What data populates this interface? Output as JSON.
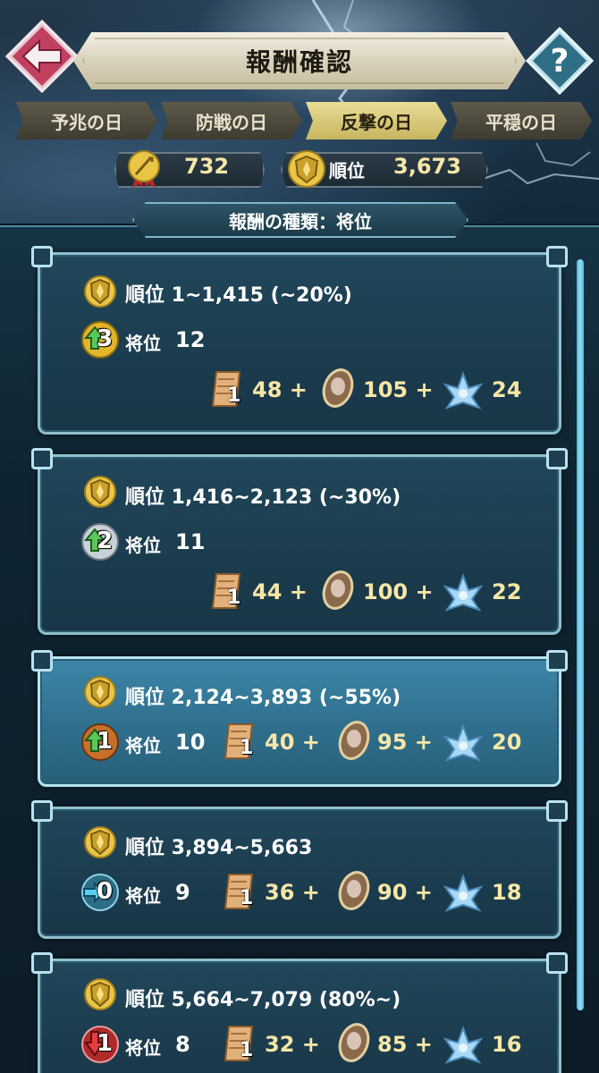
{
  "header": {
    "title": "報酬確認",
    "back_icon": "arrow-left-icon",
    "help_label": "?"
  },
  "tabs": [
    {
      "label": "予兆の日",
      "active": false
    },
    {
      "label": "防戦の日",
      "active": false
    },
    {
      "label": "反撃の日",
      "active": true
    },
    {
      "label": "平穏の日",
      "active": false
    }
  ],
  "stats": {
    "score": "732",
    "rank_label": "順位",
    "rank_value": "3,673"
  },
  "reward_type": "報酬の種類：将位",
  "tiers": [
    {
      "range": "順位 1~1,415 (~20%)",
      "change": "3",
      "change_dir": "up",
      "change_color": "gold",
      "grade_label": "将位",
      "grade_value": "12",
      "scroll_count": "1",
      "r1": "48 +",
      "r2": "105 +",
      "r3": "24"
    },
    {
      "range": "順位 1,416~2,123 (~30%)",
      "change": "2",
      "change_dir": "up",
      "change_color": "silver",
      "grade_label": "将位",
      "grade_value": "11",
      "scroll_count": "1",
      "r1": "44 +",
      "r2": "100 +",
      "r3": "22"
    },
    {
      "range": "順位 2,124~3,893 (~55%)",
      "change": "1",
      "change_dir": "up",
      "change_color": "bronze",
      "grade_label": "将位",
      "grade_value": "10",
      "scroll_count": "1",
      "r1": "40 +",
      "r2": "95 +",
      "r3": "20"
    },
    {
      "range": "順位 3,894~5,663",
      "change": "0",
      "change_dir": "flat",
      "change_color": "blue",
      "grade_label": "将位",
      "grade_value": "9",
      "scroll_count": "1",
      "r1": "36 +",
      "r2": "90 +",
      "r3": "18"
    },
    {
      "range": "順位 5,664~7,079 (80%~)",
      "change": "1",
      "change_dir": "down",
      "change_color": "red",
      "grade_label": "将位",
      "grade_value": "8",
      "scroll_count": "1",
      "r1": "32 +",
      "r2": "85 +",
      "r3": "16"
    }
  ],
  "icons": {
    "rank_icon": "shield-rank-icon",
    "reward_1": "scroll-icon",
    "reward_2": "stone-icon",
    "reward_3": "lotus-icon"
  }
}
